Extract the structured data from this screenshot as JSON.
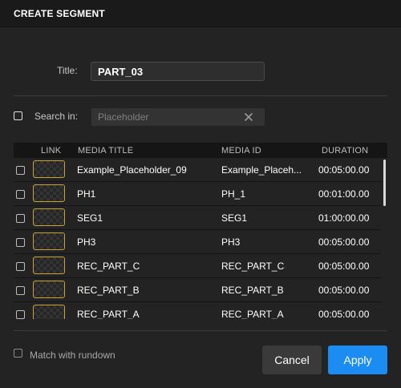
{
  "dialog": {
    "title": "CREATE SEGMENT"
  },
  "form": {
    "title_label": "Title:",
    "title_value": "PART_03",
    "search_label": "Search in:",
    "search_placeholder": "Placeholder",
    "search_checked": false
  },
  "table": {
    "headers": {
      "link": "LINK",
      "media_title": "MEDIA TITLE",
      "media_id": "MEDIA ID",
      "duration": "DURATION"
    },
    "rows": [
      {
        "media_title": "Example_Placeholder_09",
        "media_id": "Example_Placeh...",
        "duration": "00:05:00.00"
      },
      {
        "media_title": "PH1",
        "media_id": "PH_1",
        "duration": "00:01:00.00"
      },
      {
        "media_title": "SEG1",
        "media_id": "SEG1",
        "duration": "01:00:00.00"
      },
      {
        "media_title": "PH3",
        "media_id": "PH3",
        "duration": "00:05:00.00"
      },
      {
        "media_title": "REC_PART_C",
        "media_id": "REC_PART_C",
        "duration": "00:05:00.00"
      },
      {
        "media_title": "REC_PART_B",
        "media_id": "REC_PART_B",
        "duration": "00:05:00.00"
      },
      {
        "media_title": "REC_PART_A",
        "media_id": "REC_PART_A",
        "duration": "00:05:00.00"
      }
    ]
  },
  "footer": {
    "match_label": "Match with rundown",
    "cancel_label": "Cancel",
    "apply_label": "Apply"
  },
  "colors": {
    "accent": "#1b8cf2",
    "thumbnail_border": "#c8a13a",
    "background": "#232323"
  },
  "icons": {
    "clear": "close-icon",
    "thumbnail": "media-thumbnail"
  }
}
